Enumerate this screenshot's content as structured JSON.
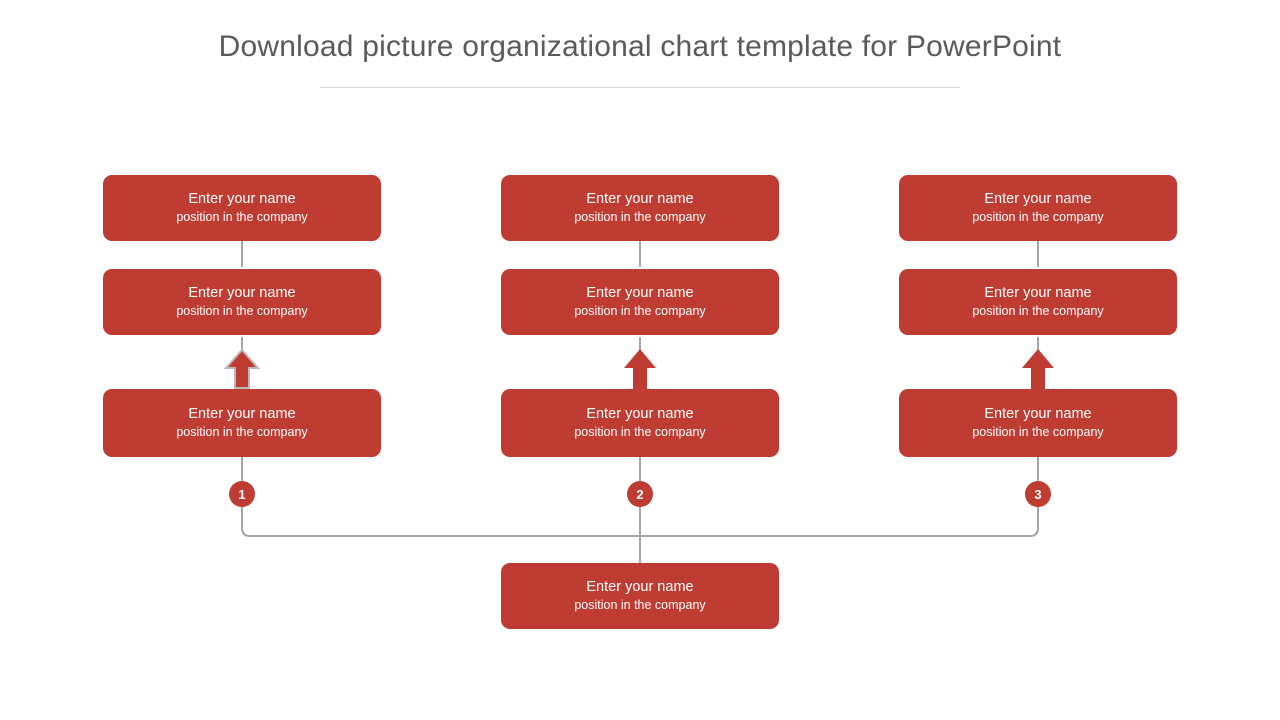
{
  "page": {
    "title": "Download picture organizational chart template for PowerPoint",
    "background_color": "#ffffff",
    "accent_color": "#bf3c32",
    "line_color": "#a6a6a6",
    "title_color": "#5a5a5a",
    "card_text_color": "#ffffff"
  },
  "chart_data": {
    "type": "diagram",
    "diagram_kind": "organizational-chart",
    "title": "Download picture organizational chart template for PowerPoint",
    "columns": 3,
    "levels_per_column": 3,
    "root": {
      "name": "Enter your name",
      "position": "position in the company"
    },
    "branches": [
      {
        "badge": "1",
        "nodes": [
          {
            "name": "Enter your name",
            "position": "position in the company"
          },
          {
            "name": "Enter your name",
            "position": "position in the company"
          },
          {
            "name": "Enter your name",
            "position": "position in the company"
          }
        ],
        "arrow": {
          "direction": "up",
          "color": "#bf3c32",
          "outline": "#b9b9b9"
        }
      },
      {
        "badge": "2",
        "nodes": [
          {
            "name": "Enter your name",
            "position": "position in the company"
          },
          {
            "name": "Enter your name",
            "position": "position in the company"
          },
          {
            "name": "Enter your name",
            "position": "position in the company"
          }
        ],
        "arrow": {
          "direction": "up",
          "color": "#bf3c32",
          "outline": "none"
        }
      },
      {
        "badge": "3",
        "nodes": [
          {
            "name": "Enter your name",
            "position": "position in the company"
          },
          {
            "name": "Enter your name",
            "position": "position in the company"
          },
          {
            "name": "Enter your name",
            "position": "position in the company"
          }
        ],
        "arrow": {
          "direction": "up",
          "color": "#bf3c32",
          "outline": "none"
        }
      }
    ]
  }
}
